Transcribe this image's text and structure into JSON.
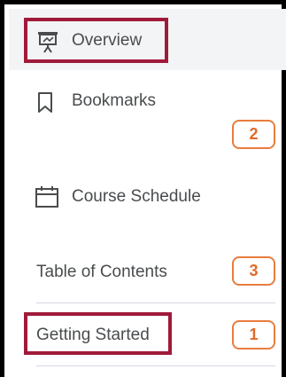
{
  "nav": {
    "overview": {
      "label": "Overview",
      "icon": "presentation-board-icon"
    },
    "bookmarks": {
      "label": "Bookmarks",
      "icon": "bookmark-icon",
      "count": "2"
    },
    "course_schedule": {
      "label": "Course Schedule",
      "icon": "calendar-icon"
    },
    "table_of_contents": {
      "label": "Table of Contents",
      "count": "3"
    },
    "getting_started": {
      "label": "Getting Started",
      "count": "1"
    }
  },
  "colors": {
    "highlight": "#a01a3a",
    "badge_border": "#e87d3e",
    "badge_text": "#e06a2a",
    "text": "#494c4e",
    "selected_bg": "#f3f4f5"
  }
}
